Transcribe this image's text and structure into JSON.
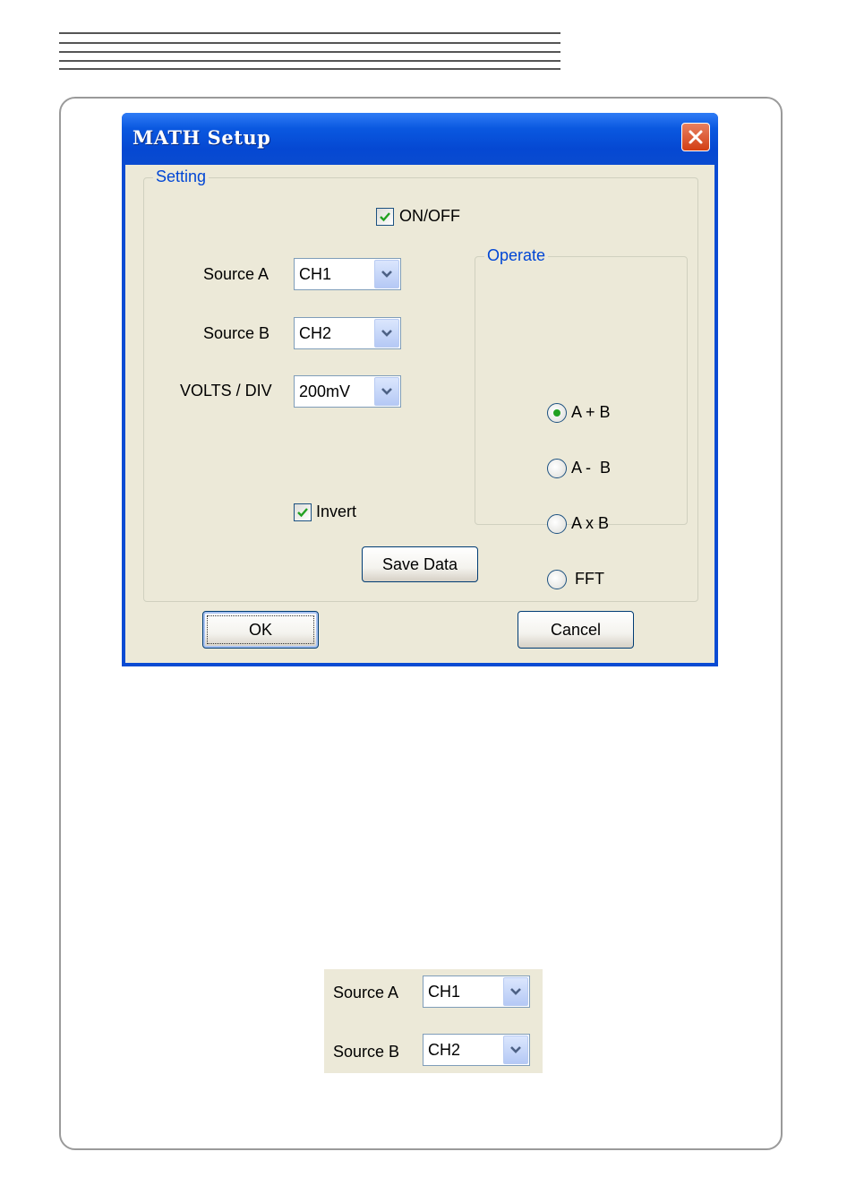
{
  "dialog": {
    "title": "MATH Setup",
    "setting_group": {
      "label": "Setting",
      "on_off": {
        "label": "ON/OFF",
        "checked": true
      },
      "source_a": {
        "label": "Source A",
        "value": "CH1"
      },
      "source_b": {
        "label": "Source B",
        "value": "CH2"
      },
      "volts_div": {
        "label": "VOLTS / DIV",
        "value": "200mV"
      },
      "invert": {
        "label": "Invert",
        "checked": true
      },
      "operate_group": {
        "label": "Operate",
        "options": [
          {
            "label": "A + B",
            "selected": true
          },
          {
            "label": "A -  B",
            "selected": false
          },
          {
            "label": "A x B",
            "selected": false
          },
          {
            "label": "FFT",
            "selected": false
          }
        ]
      },
      "save_data_label": "Save Data"
    },
    "ok_label": "OK",
    "cancel_label": "Cancel"
  },
  "inset": {
    "source_a": {
      "label": "Source A",
      "value": "CH1"
    },
    "source_b": {
      "label": "Source B",
      "value": "CH2"
    }
  },
  "colors": {
    "title_bar": "#0548d2",
    "dialog_bg": "#ece9d8",
    "group_label": "#0046d5",
    "radio_dot": "#21a121",
    "check_mark": "#21a121",
    "close_button": "#d23e14"
  }
}
